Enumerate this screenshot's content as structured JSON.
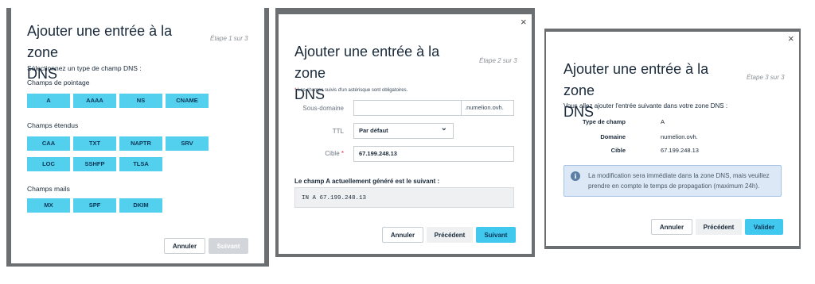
{
  "step1": {
    "title": "Ajouter une entrée à la zone DNS",
    "step": "Étape 1 sur 3",
    "prompt": "Sélectionnez un type de champ DNS :",
    "groups": [
      {
        "label": "Champs de pointage",
        "types": [
          "A",
          "AAAA",
          "NS",
          "CNAME"
        ]
      },
      {
        "label": "Champs étendus",
        "types": [
          "CAA",
          "TXT",
          "NAPTR",
          "SRV",
          "LOC",
          "SSHFP",
          "TLSA"
        ]
      },
      {
        "label": "Champs mails",
        "types": [
          "MX",
          "SPF",
          "DKIM"
        ]
      }
    ],
    "cancel_label": "Annuler",
    "next_label": "Suivant"
  },
  "step2": {
    "title": "Ajouter une entrée à la zone DNS",
    "step": "Étape 2 sur 3",
    "required_note": "Les champs suivis d'un astérisque sont obligatoires.",
    "required_mark": "*",
    "subdomain_label": "Sous-domaine",
    "subdomain_value": "",
    "subdomain_suffix": ".numelion.ovh.",
    "ttl_label": "TTL",
    "ttl_value": "Par défaut",
    "target_label": "Cible",
    "target_value": "67.199.248.13",
    "generated_label": "Le champ A actuellement généré est le suivant :",
    "generated_value": "IN A 67.199.248.13",
    "cancel_label": "Annuler",
    "prev_label": "Précédent",
    "next_label": "Suivant"
  },
  "step3": {
    "title": "Ajouter une entrée à la zone DNS",
    "step": "Étape 3 sur 3",
    "intro": "Vous allez ajouter l'entrée suivante dans votre zone DNS :",
    "summary": [
      {
        "key": "Type de champ",
        "value": "A"
      },
      {
        "key": "Domaine",
        "value": "numelion.ovh."
      },
      {
        "key": "Cible",
        "value": "67.199.248.13"
      }
    ],
    "info": "La modification sera immédiate dans la zone DNS, mais veuillez prendre en compte le temps de propagation (maximum 24h).",
    "cancel_label": "Annuler",
    "prev_label": "Précédent",
    "confirm_label": "Valider"
  },
  "common": {
    "close_glyph": "×",
    "info_glyph": "i",
    "chevron_glyph": "⌄",
    "title_line1": "Ajouter une entrée à la zone",
    "title_line2": "DNS"
  },
  "colors": {
    "primary": "#40c8ee",
    "type_button": "#52d0ee",
    "backdrop": "#6b6f72",
    "info_bg": "#dce8f5"
  }
}
